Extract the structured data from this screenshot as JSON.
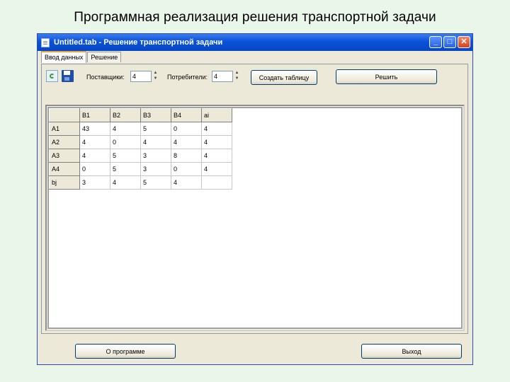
{
  "slide": {
    "title": "Программная реализация решения транспортной задачи"
  },
  "window": {
    "title": "Untitled.tab - Решение транспортной задачи",
    "minimize_glyph": "_",
    "maximize_glyph": "□",
    "close_glyph": "✕"
  },
  "tabs": [
    {
      "label": "Ввод данных"
    },
    {
      "label": "Решение"
    }
  ],
  "toolbar": {
    "refresh_icon": "refresh-icon",
    "save_icon": "save-icon",
    "suppliers_label": "Поставщики:",
    "suppliers_value": "4",
    "consumers_label": "Потребители:",
    "consumers_value": "4",
    "spin_up": "▲",
    "spin_down": "▼",
    "create_table_label": "Создать таблицу",
    "solve_label": "Решить"
  },
  "grid": {
    "header": [
      "",
      "B1",
      "B2",
      "B3",
      "B4",
      "ai"
    ],
    "rows": [
      [
        "A1",
        "43",
        "4",
        "5",
        "0",
        "4"
      ],
      [
        "A2",
        "4",
        "0",
        "4",
        "4",
        "4"
      ],
      [
        "A3",
        "4",
        "5",
        "3",
        "8",
        "4"
      ],
      [
        "A4",
        "0",
        "5",
        "3",
        "0",
        "4"
      ],
      [
        "bj",
        "3",
        "4",
        "5",
        "4",
        ""
      ]
    ]
  },
  "footer": {
    "about_label": "О программе",
    "exit_label": "Выход"
  }
}
